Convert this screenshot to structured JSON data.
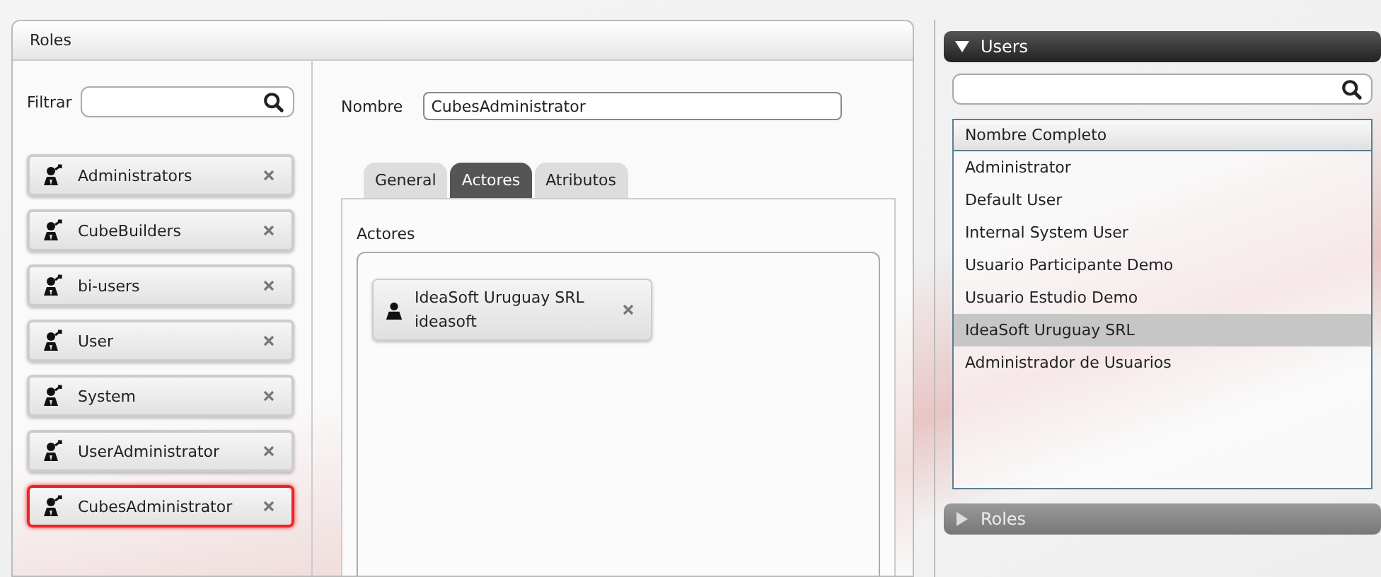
{
  "roles_panel": {
    "title": "Roles",
    "filter_label": "Filtrar",
    "roles": [
      {
        "name": "Administrators",
        "selected": false
      },
      {
        "name": "CubeBuilders",
        "selected": false
      },
      {
        "name": "bi-users",
        "selected": false
      },
      {
        "name": "User",
        "selected": false
      },
      {
        "name": "System",
        "selected": false
      },
      {
        "name": "UserAdministrator",
        "selected": false
      },
      {
        "name": "CubesAdministrator",
        "selected": true
      }
    ],
    "detail": {
      "name_label": "Nombre",
      "name_value": "CubesAdministrator",
      "tabs": [
        {
          "label": "General",
          "selected": false
        },
        {
          "label": "Actores",
          "selected": true
        },
        {
          "label": "Atributos",
          "selected": false
        }
      ],
      "section_label": "Actores",
      "actors": [
        {
          "name": "IdeaSoft Uruguay SRL",
          "login": "ideasoft"
        }
      ]
    }
  },
  "side_sections": [
    {
      "title": "Users",
      "expanded": true,
      "column": "Nombre Completo",
      "rows": [
        {
          "name": "Administrator",
          "selected": false
        },
        {
          "name": "Default User",
          "selected": false
        },
        {
          "name": "Internal System User",
          "selected": false
        },
        {
          "name": "Usuario Participante Demo",
          "selected": false
        },
        {
          "name": "Usuario Estudio Demo",
          "selected": false
        },
        {
          "name": "IdeaSoft Uruguay SRL",
          "selected": true
        },
        {
          "name": "Administrador de Usuarios",
          "selected": false
        }
      ]
    },
    {
      "title": "Roles",
      "expanded": false
    }
  ]
}
